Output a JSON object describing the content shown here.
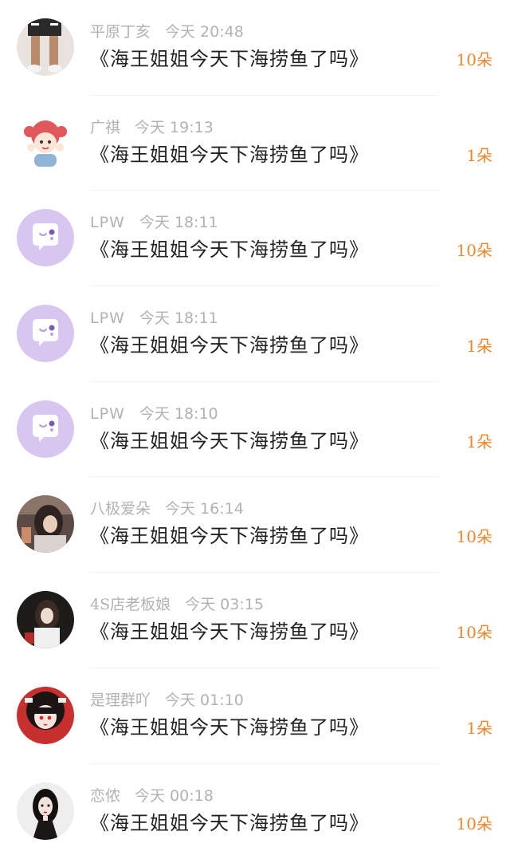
{
  "messages": [
    {
      "name": "平原丁亥",
      "time": "今天 20:48",
      "title": "《海王姐姐今天下海捞鱼了吗》",
      "count": "10朵",
      "avatar": "photo-legs"
    },
    {
      "name": "广祺",
      "time": "今天 19:13",
      "title": "《海王姐姐今天下海捞鱼了吗》",
      "count": "1朵",
      "avatar": "cartoon-girl"
    },
    {
      "name": "LPW",
      "time": "今天 18:11",
      "title": "《海王姐姐今天下海捞鱼了吗》",
      "count": "10朵",
      "avatar": "default-chat-bubble"
    },
    {
      "name": "LPW",
      "time": "今天 18:11",
      "title": "《海王姐姐今天下海捞鱼了吗》",
      "count": "1朵",
      "avatar": "default-chat-bubble"
    },
    {
      "name": "LPW",
      "time": "今天 18:10",
      "title": "《海王姐姐今天下海捞鱼了吗》",
      "count": "1朵",
      "avatar": "default-chat-bubble"
    },
    {
      "name": "八极爱朵",
      "time": "今天 16:14",
      "title": "《海王姐姐今天下海捞鱼了吗》",
      "count": "10朵",
      "avatar": "photo-woman"
    },
    {
      "name": "4S店老板娘",
      "time": "今天 03:15",
      "title": "《海王姐姐今天下海捞鱼了吗》",
      "count": "10朵",
      "avatar": "photo-woman-dark"
    },
    {
      "name": "是理群吖",
      "time": "今天 01:10",
      "title": "《海王姐姐今天下海捞鱼了吗》",
      "count": "1朵",
      "avatar": "anime-girl-red"
    },
    {
      "name": "恋侬",
      "time": "今天 00:18",
      "title": "《海王姐姐今天下海捞鱼了吗》",
      "count": "10朵",
      "avatar": "illustrated-woman"
    }
  ],
  "colors": {
    "accent": "#f0852b",
    "meta_text": "#b2b2b2",
    "title_text": "#222222",
    "default_avatar_bg": "#d9c6f0"
  }
}
